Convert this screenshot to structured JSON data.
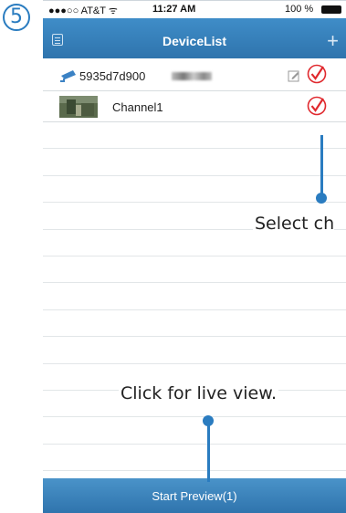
{
  "step": {
    "number": "5"
  },
  "status_bar": {
    "carrier": "●●●○○ AT&T ᯤ",
    "time": "11:27 AM",
    "battery": "100 %"
  },
  "nav": {
    "title": "DeviceList",
    "menu_icon": "list-icon",
    "add_icon": "plus-icon",
    "add_label": "+"
  },
  "devices": [
    {
      "type": "device",
      "name": "5935d7d900",
      "icon": "camera-icon",
      "edit_icon": "edit-icon",
      "checked": true
    },
    {
      "type": "channel",
      "name": "Channel1",
      "icon": "channel-thumbnail",
      "checked": true
    }
  ],
  "bottom_bar": {
    "label": "Start Preview(1)"
  },
  "callouts": {
    "select": "Select ch",
    "live_view": "Click for live view."
  },
  "colors": {
    "nav": "#3a86c2",
    "accent": "#2a7cc0",
    "check": "#e0292e"
  }
}
